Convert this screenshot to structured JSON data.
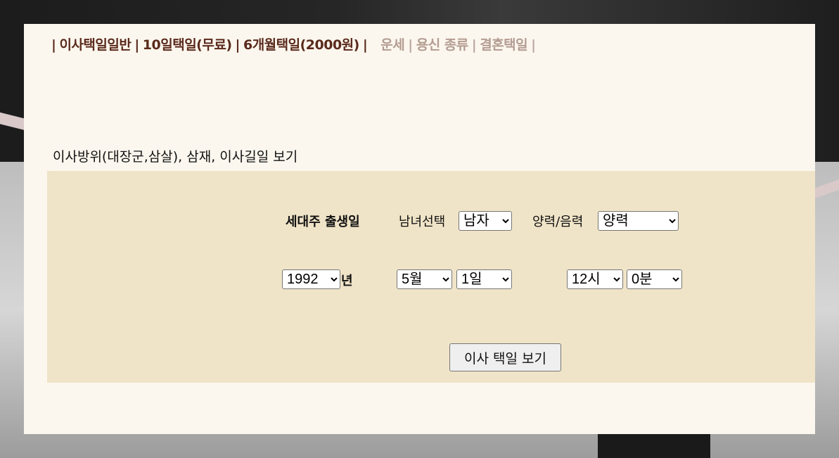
{
  "nav": {
    "links": [
      {
        "label": "이사택일일반"
      },
      {
        "label": "10일택일(무료)"
      },
      {
        "label": "6개월택일(2000원)"
      }
    ],
    "sublinks": [
      {
        "label": "운세"
      },
      {
        "label": "용신 종류"
      },
      {
        "label": "결혼택일"
      }
    ],
    "separator": "|"
  },
  "subtitle": "이사방위(대장군,삼살), 삼재, 이사길일 보기",
  "form": {
    "birth_label": "세대주 출생일",
    "gender_label": "남녀선택",
    "gender_value": "남자",
    "calendar_label": "양력/음력",
    "calendar_value": "양력",
    "year_value": "1992",
    "year_suffix": "년",
    "month_value": "5월",
    "day_value": "1일",
    "hour_value": "12시",
    "minute_value": "0분",
    "submit_label": "이사 택일 보기"
  },
  "colors": {
    "nav_primary": "#5a2a1c",
    "nav_secondary": "#b39c92",
    "panel_bg": "#fcf7ee",
    "form_bg": "#f0e4c8"
  }
}
